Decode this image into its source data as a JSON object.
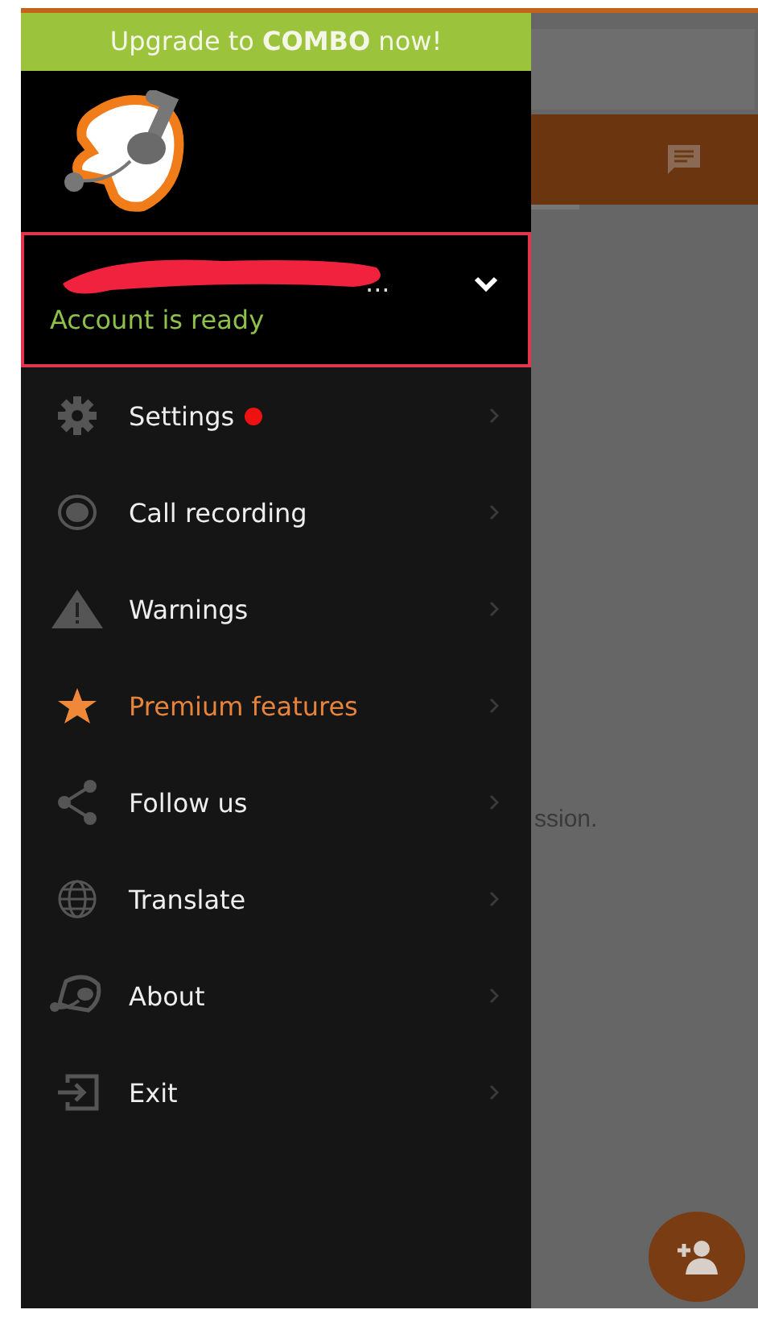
{
  "drawer": {
    "banner": "Upgrade to **COMBO** now!",
    "account": {
      "name": "...",
      "status": "Account is ready",
      "expanded": false
    },
    "items": [
      {
        "label": "Settings",
        "badge": true,
        "highlighted": false
      },
      {
        "label": "Call recording",
        "badge": false,
        "highlighted": false
      },
      {
        "label": "Warnings",
        "badge": false,
        "highlighted": false
      },
      {
        "label": "Premium features",
        "badge": false,
        "highlighted": true
      },
      {
        "label": "Follow us",
        "badge": false,
        "highlighted": false
      },
      {
        "label": "Translate",
        "badge": false,
        "highlighted": false
      },
      {
        "label": "About",
        "badge": false,
        "highlighted": false
      },
      {
        "label": "Exit",
        "badge": false,
        "highlighted": false
      }
    ]
  },
  "background": {
    "text_fragment": "ssion."
  }
}
